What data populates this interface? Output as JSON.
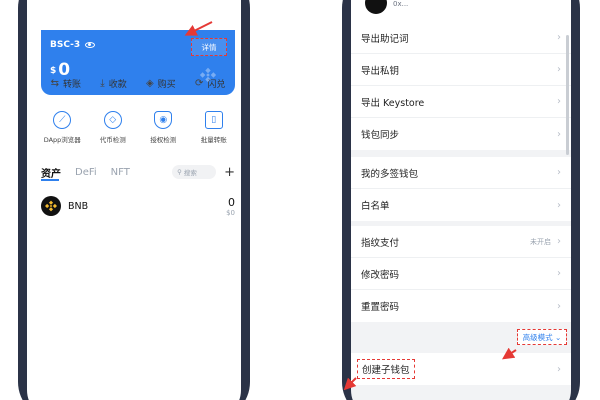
{
  "left": {
    "card": {
      "network": "BSC-3",
      "currency_symbol": "$",
      "balance": "0",
      "detail_label": "详情"
    },
    "actions": [
      {
        "label": "转账",
        "icon": "swap-arrows-icon"
      },
      {
        "label": "收款",
        "icon": "receive-download-icon"
      },
      {
        "label": "购买",
        "icon": "tag-icon"
      },
      {
        "label": "闪兑",
        "icon": "exchange-icon"
      }
    ],
    "features": [
      {
        "label": "DApp浏览器",
        "icon": "compass-icon"
      },
      {
        "label": "代币检测",
        "icon": "token-check-icon"
      },
      {
        "label": "授权检测",
        "icon": "shield-icon"
      },
      {
        "label": "批量转账",
        "icon": "batch-transfer-icon"
      }
    ],
    "tabs": [
      "资产",
      "DeFi",
      "NFT"
    ],
    "search_placeholder": "搜索",
    "assets": [
      {
        "name": "BNB",
        "amount": "0",
        "usd": "$0"
      }
    ]
  },
  "right": {
    "address": "0x...",
    "group1": [
      {
        "label": "导出助记词"
      },
      {
        "label": "导出私钥"
      },
      {
        "label": "导出 Keystore"
      },
      {
        "label": "钱包同步"
      }
    ],
    "group2": [
      {
        "label": "我的多签钱包"
      },
      {
        "label": "白名单"
      }
    ],
    "group3": [
      {
        "label": "指纹支付",
        "value": "未开启"
      },
      {
        "label": "修改密码"
      },
      {
        "label": "重置密码"
      }
    ],
    "advanced_label": "高级模式",
    "create_sub_wallet": "创建子钱包"
  },
  "colors": {
    "accent_blue": "#2f80ed",
    "highlight_red": "#e53935",
    "phone_frame": "#2b3347"
  }
}
